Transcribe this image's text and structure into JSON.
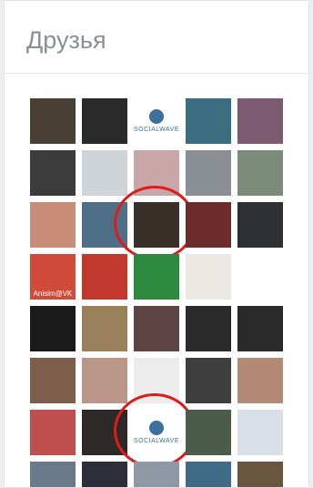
{
  "widget": {
    "title": "Друзья"
  },
  "friends": [
    {
      "color": "#4a3f35"
    },
    {
      "color": "#2a2a2a"
    },
    {
      "color": "#ffffff",
      "type": "socialwave",
      "label": "SOCIALWAVE"
    },
    {
      "color": "#3a6d7f"
    },
    {
      "color": "#7b5a72"
    },
    {
      "color": "#3b3b3b"
    },
    {
      "color": "#cfd4d8"
    },
    {
      "color": "#c9a7a8"
    },
    {
      "color": "#8a8f96"
    },
    {
      "color": "#7c8c7a"
    },
    {
      "color": "#c88d79"
    },
    {
      "color": "#4e6f86"
    },
    {
      "color": "#3b2f2a",
      "circled": true
    },
    {
      "color": "#6b2c2c"
    },
    {
      "color": "#2e2f33"
    },
    {
      "color": "#d14b3a",
      "label": "Anisim@VK"
    },
    {
      "color": "#c3382d"
    },
    {
      "color": "#2b8a3e"
    },
    {
      "color": "#ece9e4"
    },
    {
      "color": "#ffffff"
    },
    {
      "color": "#1b1b1b"
    },
    {
      "color": "#9a7f5b"
    },
    {
      "color": "#5e4444"
    },
    {
      "color": "#2a2a2a"
    },
    {
      "color": "#2b2b2b"
    },
    {
      "color": "#7c5e4a"
    },
    {
      "color": "#b99687"
    },
    {
      "color": "#ececec"
    },
    {
      "color": "#3e3e3e"
    },
    {
      "color": "#b28a76"
    },
    {
      "color": "#c04f4f"
    },
    {
      "color": "#2d2929"
    },
    {
      "color": "#ffffff",
      "type": "socialwave",
      "label": "SOCIALWAVE",
      "circled": true
    },
    {
      "color": "#4a5c4a"
    },
    {
      "color": "#d9dfe6"
    },
    {
      "color": "#6b7a8a"
    },
    {
      "color": "#2c2f3a"
    },
    {
      "color": "#8f98a5"
    },
    {
      "color": "#3f6b87"
    },
    {
      "color": "#6a553f"
    }
  ],
  "colors": {
    "accent_ring": "#e01a1a",
    "socialwave": "#3d6f9c"
  }
}
